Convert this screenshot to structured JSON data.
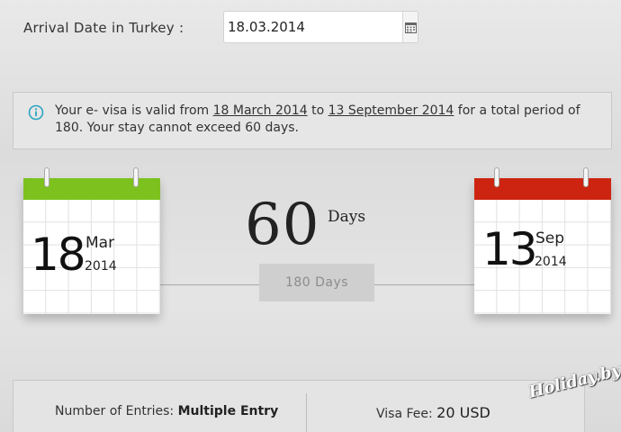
{
  "arrival": {
    "label": "Arrival Date in Turkey :",
    "date_value": "18.03.2014",
    "calendar_icon": "calendar-icon"
  },
  "info": {
    "icon": "info-icon",
    "text_part1": "Your e- visa is valid from ",
    "start_link": "18 March 2014",
    "text_part2": " to ",
    "end_link": "13 September 2014",
    "text_part3": " for a total period of 180. Your stay cannot exceed 60 days."
  },
  "start_calendar": {
    "day": "18",
    "month": "Mar",
    "year": "2014",
    "band_color": "#7cc11e"
  },
  "end_calendar": {
    "day": "13",
    "month": "Sep",
    "year": "2014",
    "band_color": "#cc2410"
  },
  "duration": {
    "number": "60",
    "unit": "Days",
    "total": "180 Days"
  },
  "summary": {
    "entries_label": "Number of Entries: ",
    "entries_value": "Multiple Entry",
    "fee_label": "Visa Fee: ",
    "fee_value": "20 USD"
  },
  "watermark": "Holiday.by"
}
